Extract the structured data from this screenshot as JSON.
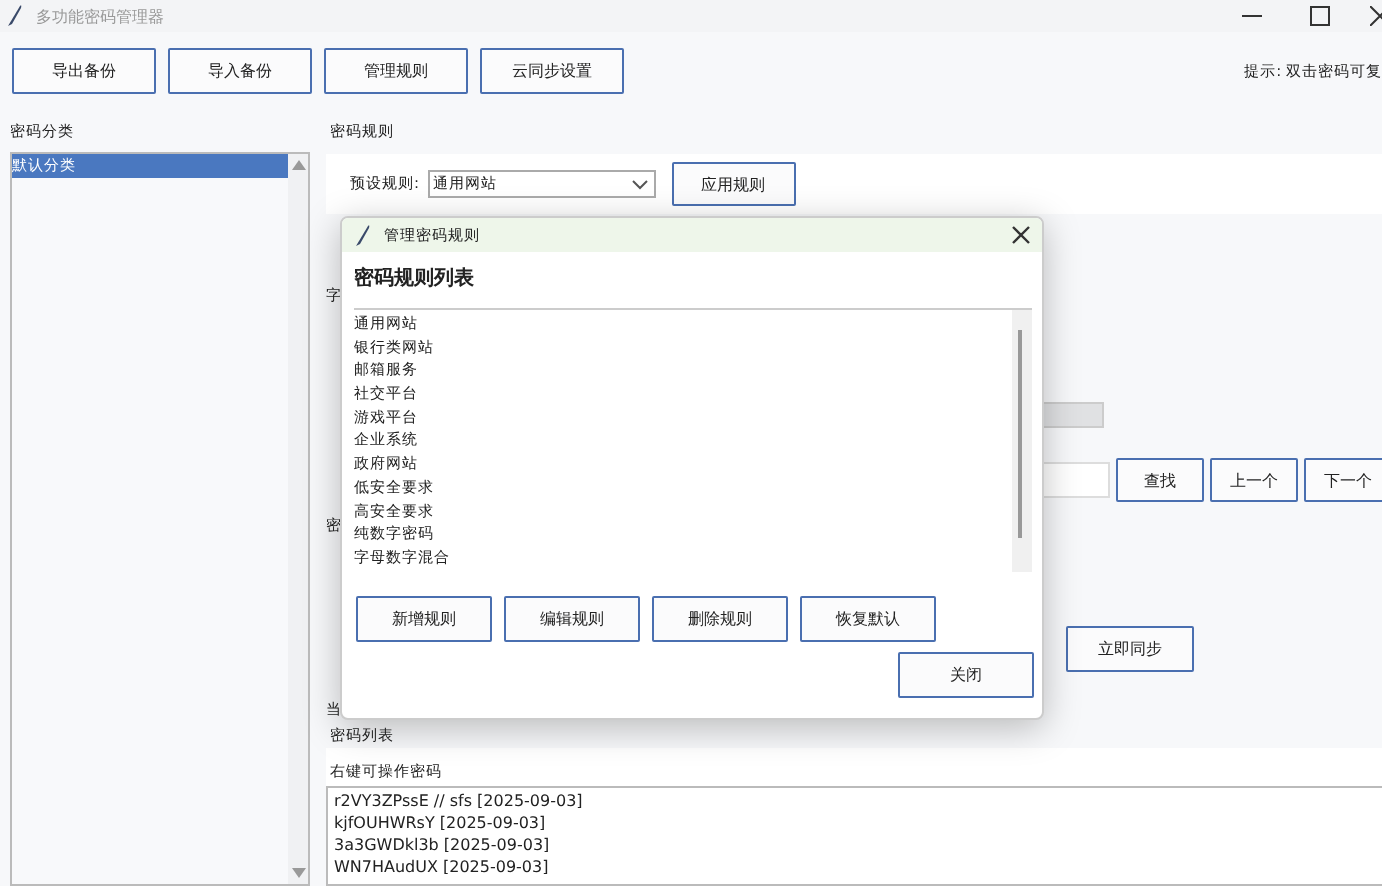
{
  "window": {
    "title": "多功能密码管理器"
  },
  "toolbar": {
    "buttons": [
      "导出备份",
      "导入备份",
      "管理规则",
      "云同步设置"
    ],
    "hint": "提示: 双击密码可复"
  },
  "categories": {
    "label": "密码分类",
    "items": [
      {
        "label": "默认分类",
        "selected": true
      }
    ]
  },
  "rules": {
    "label": "密码规则",
    "preset_label": "预设规则:",
    "preset_value": "通用网站",
    "apply_button": "应用规则"
  },
  "covered_labels": [
    "字",
    "密",
    "当"
  ],
  "readonly_field": {
    "disabled": true
  },
  "search": {
    "buttons": [
      "查找",
      "上一个",
      "下一个"
    ]
  },
  "sync": {
    "button": "立即同步"
  },
  "password_list": {
    "label": "密码列表",
    "hint": "右键可操作密码",
    "entries": [
      "r2VY3ZPssE  // sfs  [2025-09-03]",
      "kjfOUHWRsY  [2025-09-03]",
      "3a3GWDkl3b  [2025-09-03]",
      "WN7HAudUX  [2025-09-03]"
    ]
  },
  "dialog": {
    "title": "管理密码规则",
    "heading": "密码规则列表",
    "rules": [
      "通用网站",
      "银行类网站",
      "邮箱服务",
      "社交平台",
      "游戏平台",
      "企业系统",
      "政府网站",
      "低安全要求",
      "高安全要求",
      "纯数字密码",
      "字母数字混合"
    ],
    "buttons": [
      "新增规则",
      "编辑规则",
      "删除规则",
      "恢复默认"
    ],
    "close_button": "关闭"
  }
}
